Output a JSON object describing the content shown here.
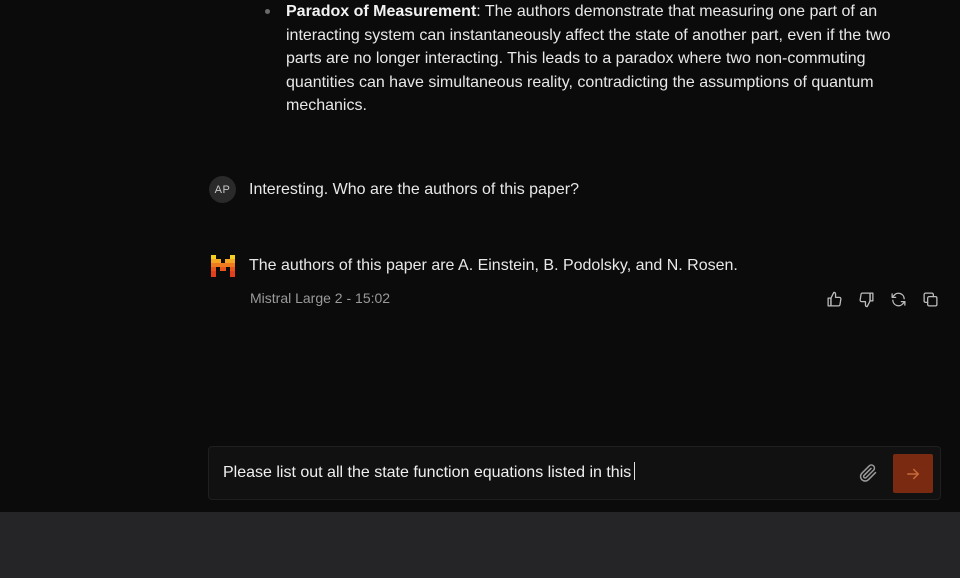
{
  "previous_answer": {
    "bullet_title": "Paradox of Measurement",
    "bullet_text": ": The authors demonstrate that measuring one part of an interacting system can instantaneously affect the state of another part, even if the two parts are no longer interacting. This leads to a paradox where two non-commuting quantities can have simultaneous reality, contradicting the assumptions of quantum mechanics."
  },
  "user_message": {
    "avatar_initials": "AP",
    "text": "Interesting. Who are the authors of this paper?"
  },
  "assistant_message": {
    "text": "The authors of this paper are A. Einstein, B. Podolsky, and N. Rosen.",
    "meta": "Mistral Large 2 - 15:02",
    "logo_icon": "mistral-logo-icon"
  },
  "message_actions": [
    {
      "name": "thumbs-up-icon"
    },
    {
      "name": "thumbs-down-icon"
    },
    {
      "name": "regenerate-icon"
    },
    {
      "name": "copy-icon"
    }
  ],
  "composer": {
    "value": "Please list out all the state function equations listed in this",
    "attach_icon": "paperclip-icon",
    "send_icon": "arrow-right-icon"
  },
  "colors": {
    "background": "#0b0b0b",
    "send_button": "#7a2a10",
    "footer": "#252528",
    "logo_orange": "#f5a623",
    "logo_red": "#e2401c"
  }
}
